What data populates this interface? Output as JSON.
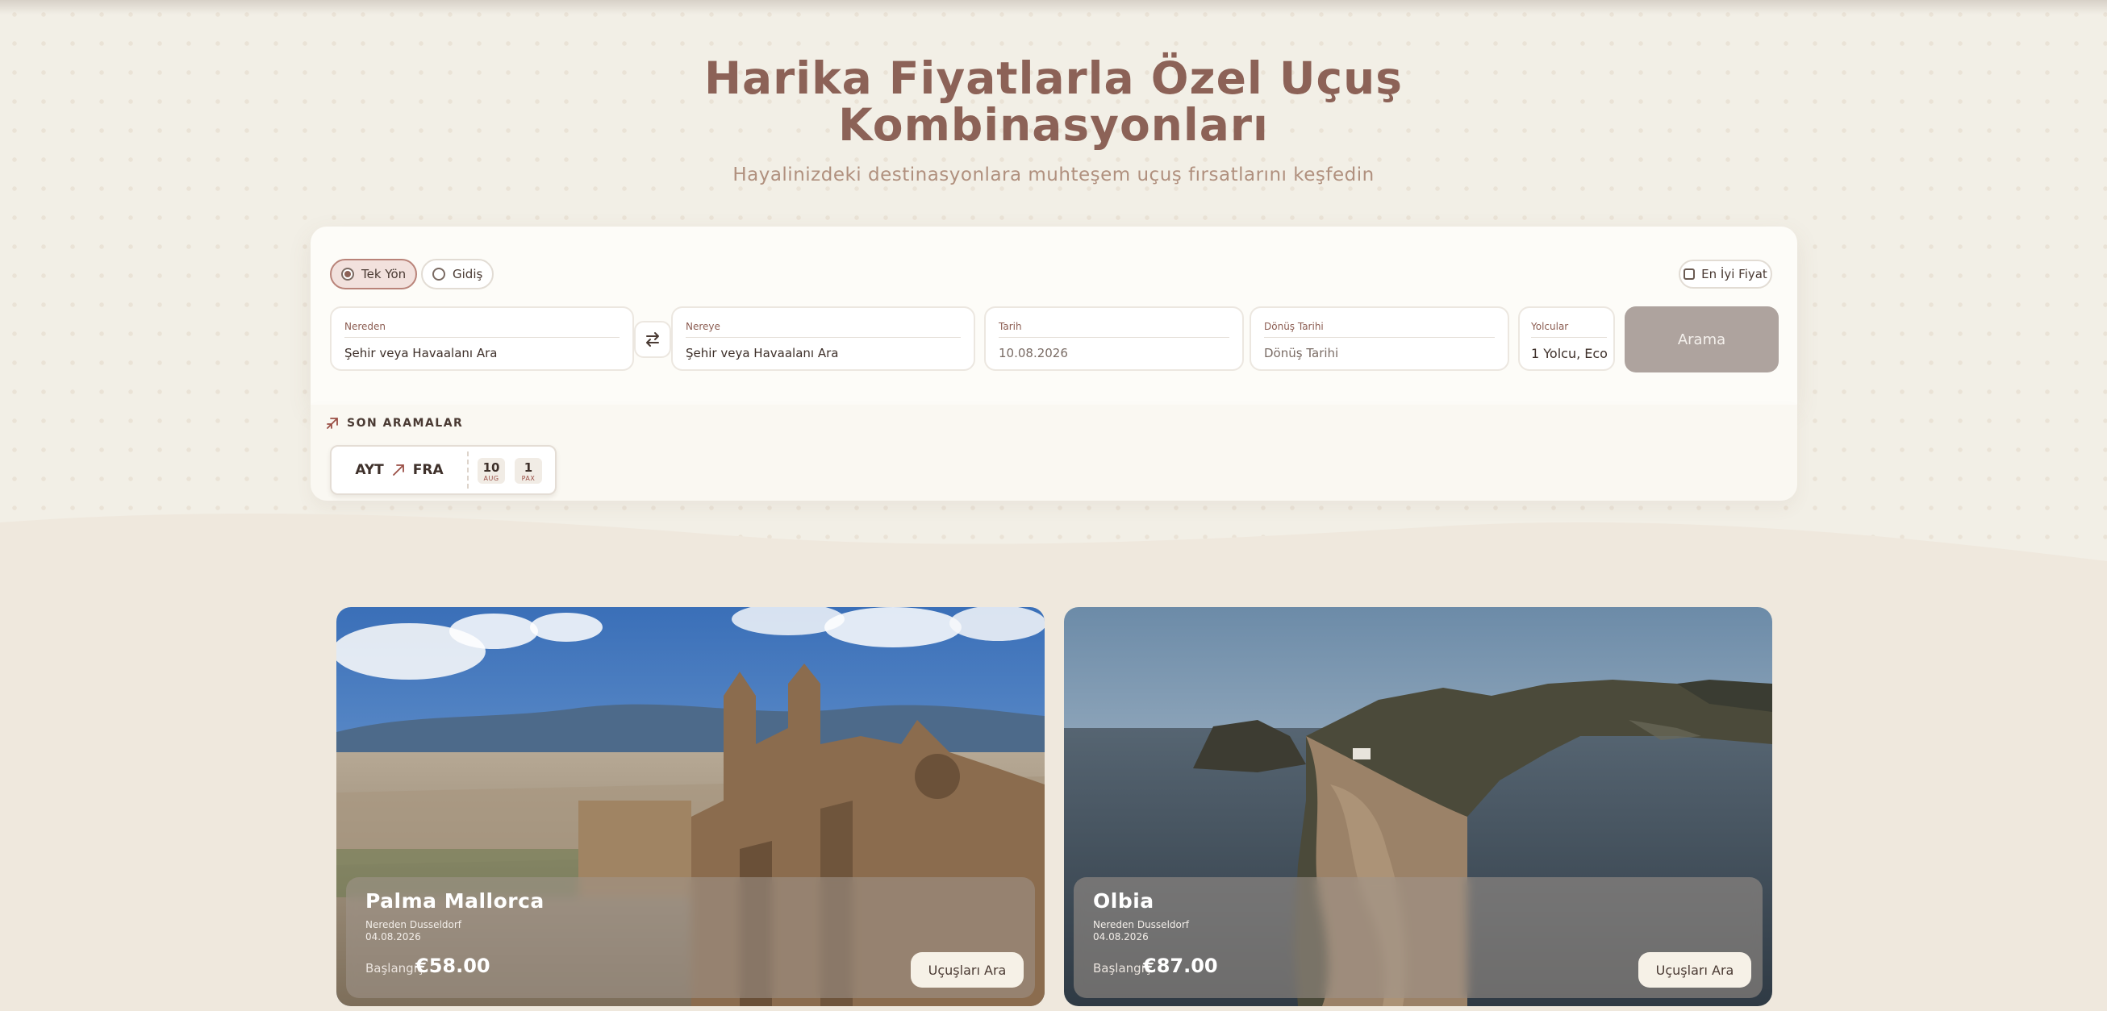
{
  "hero": {
    "title": "Harika Fiyatlarla Özel Uçuş Kombinasyonları",
    "subtitle": "Hayalinizdeki destinasyonlara muhteşem uçuş fırsatlarını keşfedin"
  },
  "search": {
    "trip_types": [
      {
        "label": "Tek Yön",
        "selected": true
      },
      {
        "label": "Gidiş",
        "selected": false
      }
    ],
    "best_price_label": "En İyi Fiyat",
    "from": {
      "label": "Nereden",
      "placeholder": "Şehir veya Havaalanı Ara"
    },
    "to": {
      "label": "Nereye",
      "placeholder": "Şehir veya Havaalanı Ara"
    },
    "date": {
      "label": "Tarih",
      "value": "10.08.2026"
    },
    "return_date": {
      "label": "Dönüş Tarihi",
      "placeholder": "Dönüş Tarihi"
    },
    "passengers": {
      "label": "Yolcular",
      "value": "1 Yolcu, Eco"
    },
    "search_button": "Arama"
  },
  "recent": {
    "title": "SON ARAMALAR",
    "items": [
      {
        "from": "AYT",
        "to": "FRA",
        "day": "10",
        "month": "AUG",
        "pax": "1",
        "pax_label": "PAX"
      }
    ]
  },
  "destinations": [
    {
      "name": "Palma Mallorca",
      "from": "Nereden Dusseldorf",
      "date": "04.08.2026",
      "price_label": "Başlangıç",
      "price": "€58.00",
      "button": "Uçuşları Ara"
    },
    {
      "name": "Olbia",
      "from": "Nereden Dusseldorf",
      "date": "04.08.2026",
      "price_label": "Başlangıç",
      "price": "€87.00",
      "button": "Uçuşları Ara"
    }
  ],
  "colors": {
    "accent": "#8c6257",
    "background": "#f2efe6",
    "search_button": "#aea39e"
  }
}
